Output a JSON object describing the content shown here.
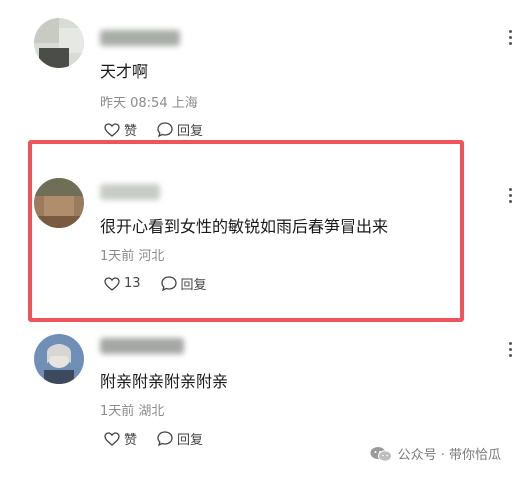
{
  "comments": [
    {
      "text": "天才啊",
      "meta": "昨天 08:54 上海",
      "like_label": "赞",
      "reply_label": "回复"
    },
    {
      "text": "很开心看到女性的敏锐如雨后春笋冒出来",
      "meta": "1天前 河北",
      "like_label": "13",
      "reply_label": "回复"
    },
    {
      "text": "附亲附亲附亲附亲",
      "meta": "1天前 湖北",
      "like_label": "赞",
      "reply_label": "回复"
    }
  ],
  "watermark": {
    "text": "公众号 · 带你恰瓜"
  },
  "colors": {
    "highlight_border": "#f0545a",
    "meta_text": "#8c8c8c"
  },
  "icons": {
    "like": "heart-outline-icon",
    "reply": "speech-bubble-icon",
    "more": "vertical-dots-icon",
    "watermark": "wechat-icon"
  }
}
